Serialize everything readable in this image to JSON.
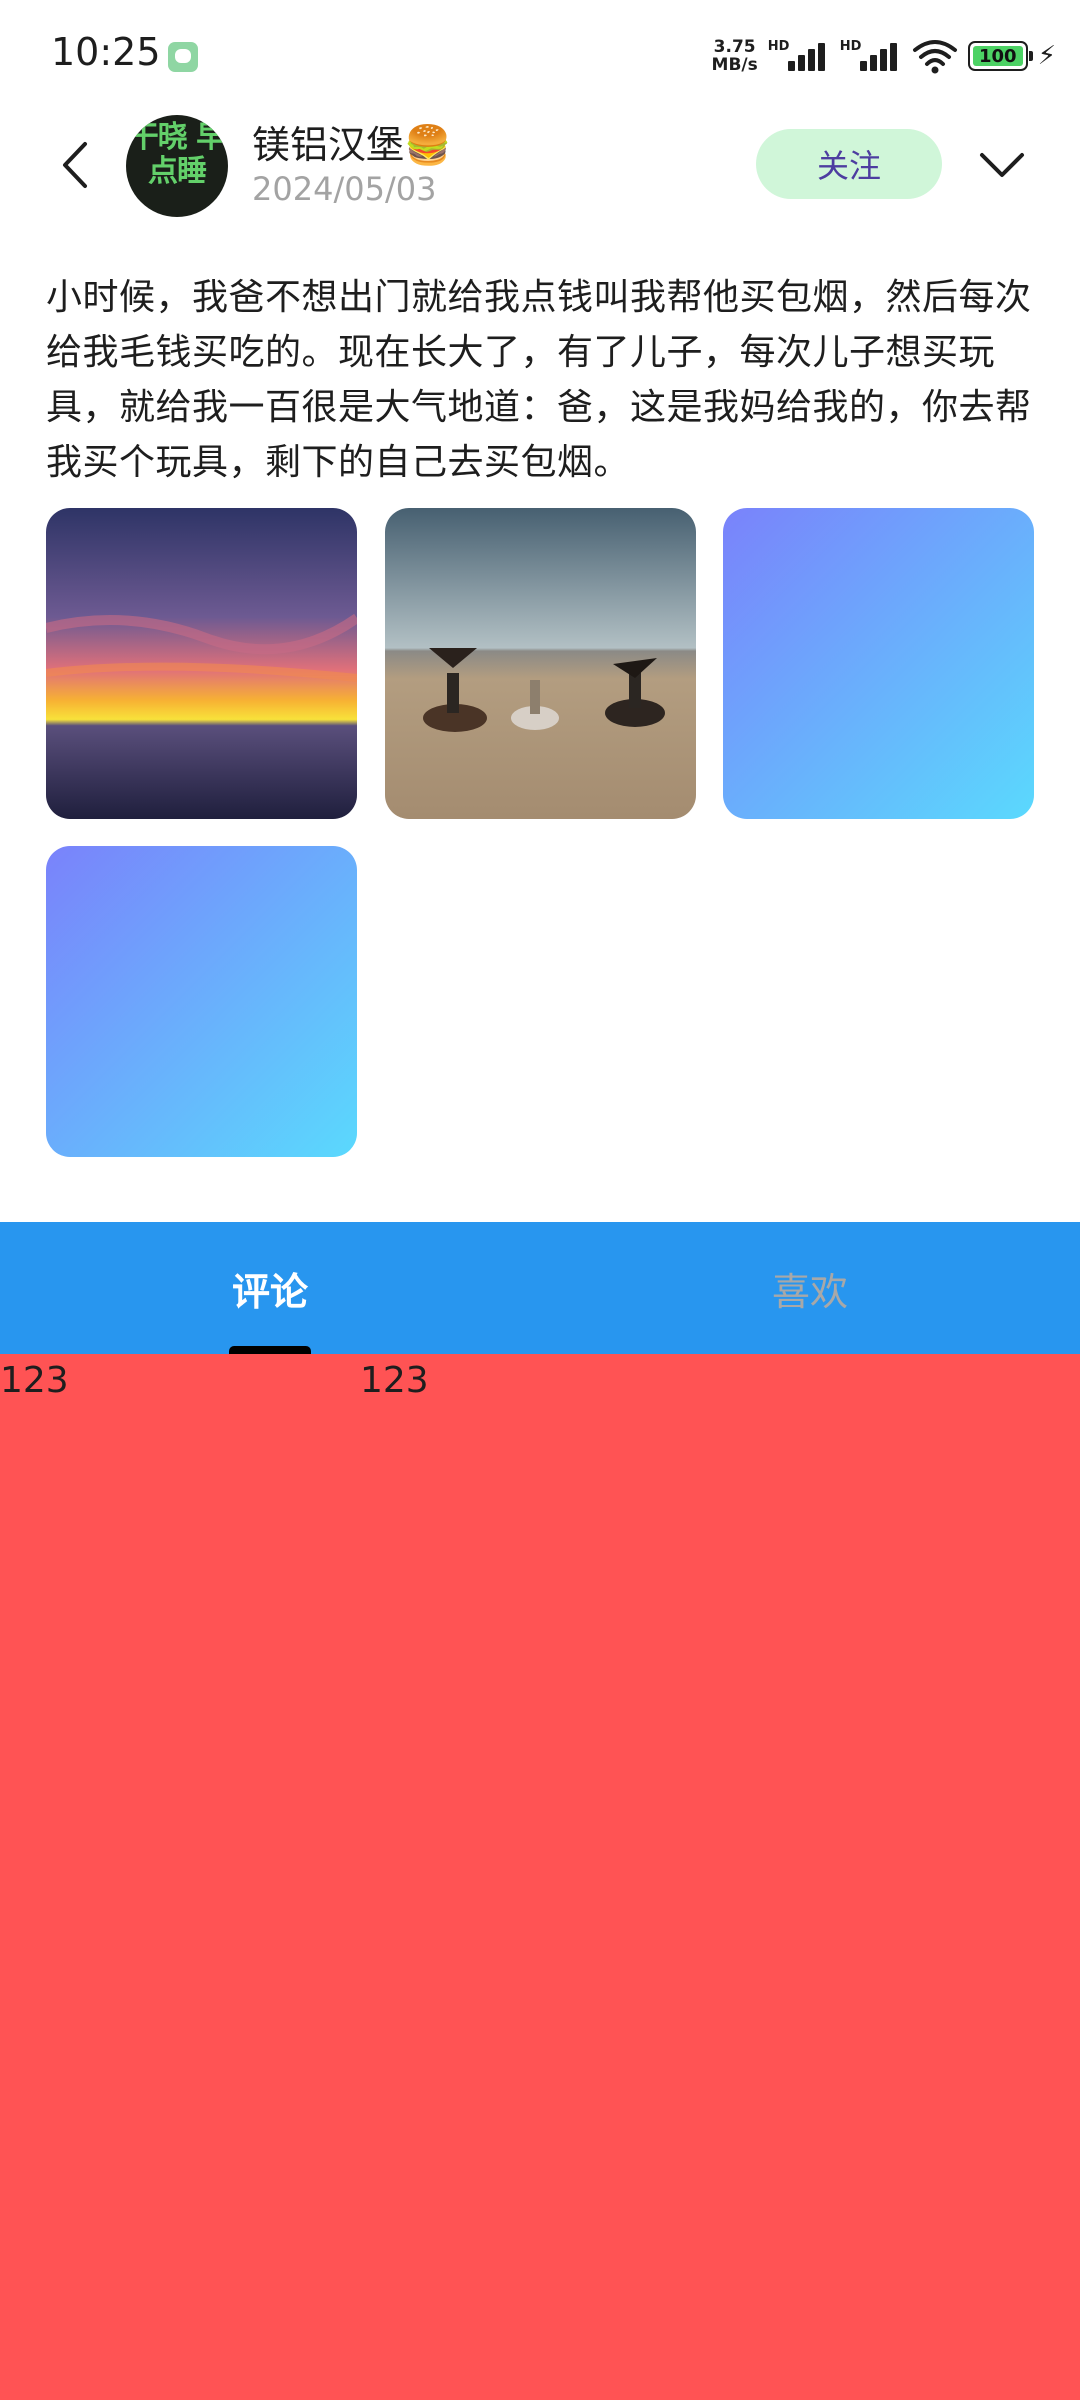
{
  "status_bar": {
    "time": "10:25",
    "net_speed_value": "3.75",
    "net_speed_unit": "MB/s",
    "sim1_label": "HD",
    "sim2_label": "HD",
    "battery": "100"
  },
  "header": {
    "avatar_text": "干晓 早点睡",
    "user_name": "镁铝汉堡🍔",
    "date": "2024/05/03",
    "follow_label": "关注"
  },
  "post": {
    "text": "小时候，我爸不想出门就给我点钱叫我帮他买包烟，然后每次给我毛钱买吃的。现在长大了，有了儿子，每次儿子想买玩具，就给我一百很是大气地道：爸，这是我妈给我的，你去帮我买个玩具，剩下的自己去买包烟。",
    "images": [
      "sunset-sea",
      "desert-eagle-hunters",
      "blue-gradient",
      "blue-gradient"
    ]
  },
  "tabs": [
    {
      "label": "评论",
      "active": true
    },
    {
      "label": "喜欢",
      "active": false
    }
  ],
  "content": {
    "items": [
      "123",
      "123"
    ]
  },
  "colors": {
    "tab_bar": "#2896ef",
    "content_bg": "#ff5354",
    "follow_bg": "#d0f6d9",
    "follow_text": "#4d3da0"
  }
}
